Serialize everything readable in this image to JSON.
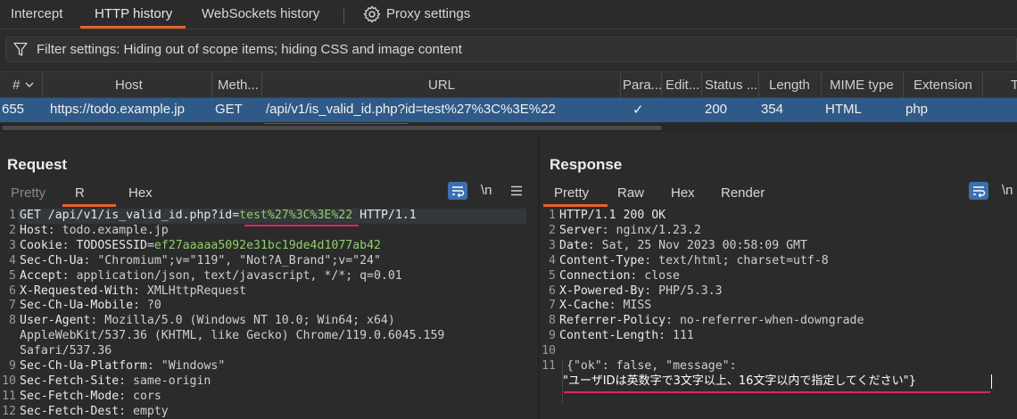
{
  "tabs": {
    "intercept": "Intercept",
    "http_history": "HTTP history",
    "websockets_history": "WebSockets history",
    "proxy_settings": "Proxy settings"
  },
  "filter": {
    "text": "Filter settings: Hiding out of scope items;  hiding CSS and image content"
  },
  "table": {
    "columns": [
      "#",
      "Host",
      "Meth...",
      "URL",
      "Para...",
      "Edit...",
      "Status ...",
      "Length",
      "MIME type",
      "Extension",
      "T"
    ],
    "row": {
      "num": "655",
      "host": "https://todo.example.jp",
      "method": "GET",
      "url": "/api/v1/is_valid_id.php?id=test%27%3C%3E%22",
      "params": "✓",
      "status": "200",
      "length": "354",
      "mime": "HTML",
      "extension": "php"
    }
  },
  "request": {
    "title": "Request",
    "tabs": {
      "pretty": "Pretty",
      "raw": "R",
      "hex": "Hex"
    },
    "newline": "\\n",
    "lines": [
      {
        "n": "1",
        "key": "GET /api/v1/is_valid_id.php?",
        "rest_key": "id",
        "eq": "=",
        "green": "test%27%3C%3E%22",
        "tail": " HTTP/1.1"
      },
      {
        "n": "2",
        "key": "Host",
        "val": ": todo.example.jp"
      },
      {
        "n": "3",
        "key": "Cookie",
        "val": ": ",
        "cookie_name": "TODOSESSID",
        "cookie_eq": "=",
        "cookie_val": "ef27aaaaa5092e31bc19de4d1077ab42"
      },
      {
        "n": "4",
        "key": "Sec-Ch-Ua",
        "val": ": \"Chromium\";v=\"119\", \"Not?A_Brand\";v=\"24\""
      },
      {
        "n": "5",
        "key": "Accept",
        "val": ": application/json, text/javascript, */*; q=0.01"
      },
      {
        "n": "6",
        "key": "X-Requested-With",
        "val": ": XMLHttpRequest"
      },
      {
        "n": "7",
        "key": "Sec-Ch-Ua-Mobile",
        "val": ": ?0"
      },
      {
        "n": "8",
        "key": "User-Agent",
        "val": ": Mozilla/5.0 (Windows NT 10.0; Win64; x64)"
      },
      {
        "n": "",
        "key": "",
        "val": "AppleWebKit/537.36 (KHTML, like Gecko) Chrome/119.0.6045.159"
      },
      {
        "n": "",
        "key": "",
        "val": "Safari/537.36"
      },
      {
        "n": "9",
        "key": "Sec-Ch-Ua-Platform",
        "val": ": \"Windows\""
      },
      {
        "n": "10",
        "key": "Sec-Fetch-Site",
        "val": ": same-origin"
      },
      {
        "n": "11",
        "key": "Sec-Fetch-Mode",
        "val": ": cors"
      },
      {
        "n": "12",
        "key": "Sec-Fetch-Dest",
        "val": ": empty"
      }
    ]
  },
  "response": {
    "title": "Response",
    "tabs": {
      "pretty": "Pretty",
      "raw": "Raw",
      "hex": "Hex",
      "render": "Render"
    },
    "newline": "\\n",
    "lines": [
      {
        "n": "1",
        "key": "HTTP/1.1 200 OK",
        "val": ""
      },
      {
        "n": "2",
        "key": "Server",
        "val": ": nginx/1.23.2"
      },
      {
        "n": "3",
        "key": "Date",
        "val": ": Sat, 25 Nov 2023 00:58:09 GMT"
      },
      {
        "n": "4",
        "key": "Content-Type",
        "val": ": text/html; charset=utf-8"
      },
      {
        "n": "5",
        "key": "Connection",
        "val": ": close"
      },
      {
        "n": "6",
        "key": "X-Powered-By",
        "val": ": PHP/5.3.3"
      },
      {
        "n": "7",
        "key": "X-Cache",
        "val": ": MISS"
      },
      {
        "n": "8",
        "key": "Referrer-Policy",
        "val": ": no-referrer-when-downgrade"
      },
      {
        "n": "9",
        "key": "Content-Length",
        "val": ": 111"
      },
      {
        "n": "10",
        "key": "",
        "val": ""
      },
      {
        "n": "11",
        "key": "",
        "val": "{\"ok\": false, \"message\":"
      },
      {
        "n": "",
        "key": "",
        "val": "\"ユーザIDは英数字で3文字以上、16文字以内で指定してください\"}"
      }
    ]
  },
  "colors": {
    "accent_tab": "#e8612c",
    "selected_row": "#2f5a87",
    "highlight_underline": "#e0245e",
    "param_value": "#8ecf6b"
  }
}
